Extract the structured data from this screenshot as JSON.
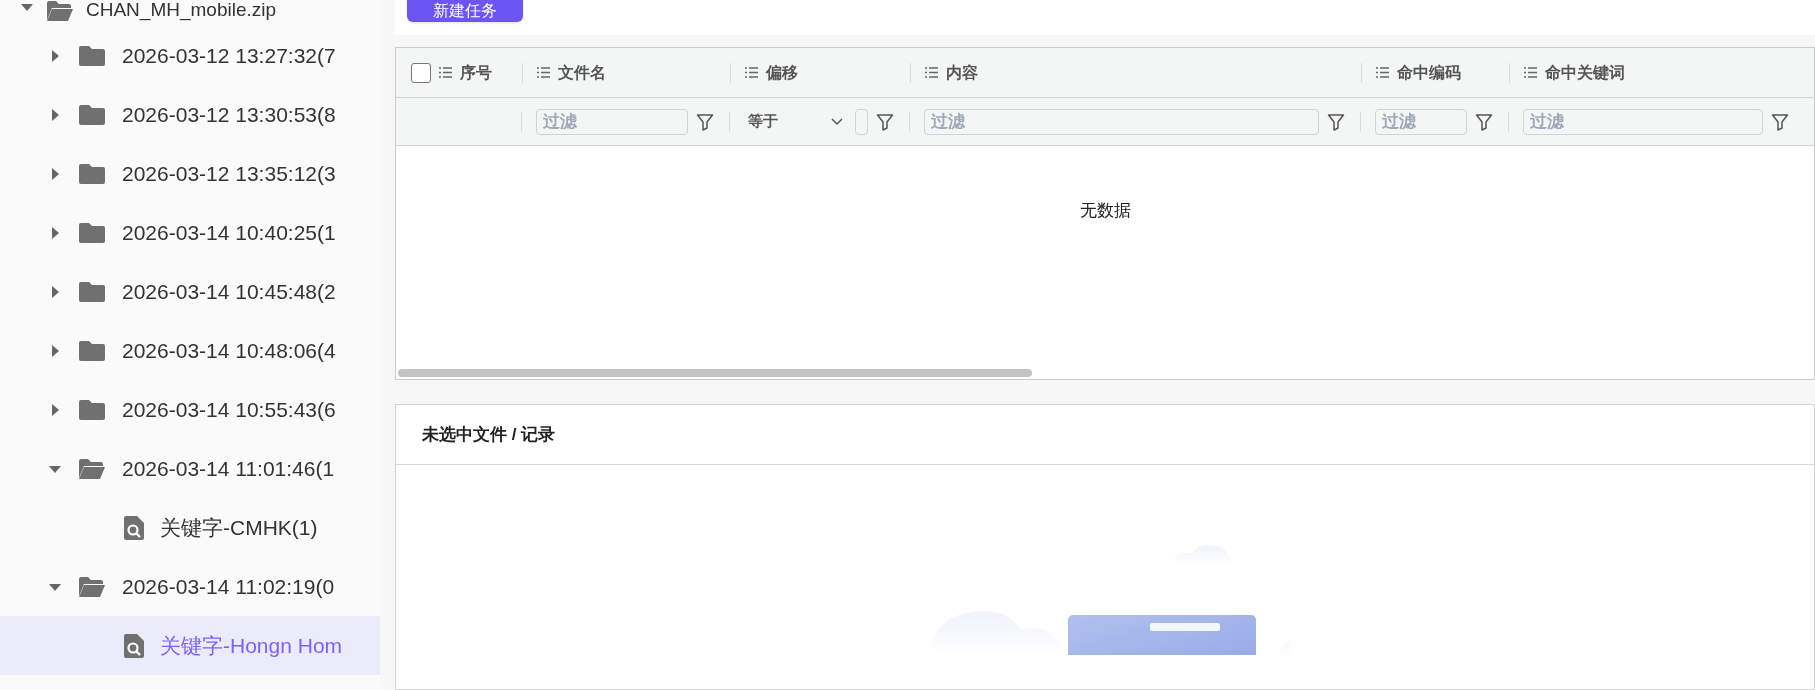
{
  "sidebar": {
    "root": {
      "label": "CHAN_MH_mobile.zip",
      "expanded": true
    },
    "items": [
      {
        "label": "2026-03-12 13:27:32(7",
        "expanded": false,
        "selected": false
      },
      {
        "label": "2026-03-12 13:30:53(8",
        "expanded": false,
        "selected": false
      },
      {
        "label": "2026-03-12 13:35:12(3",
        "expanded": false,
        "selected": false
      },
      {
        "label": "2026-03-14 10:40:25(1",
        "expanded": false,
        "selected": false
      },
      {
        "label": "2026-03-14 10:45:48(2",
        "expanded": false,
        "selected": false
      },
      {
        "label": "2026-03-14 10:48:06(4",
        "expanded": false,
        "selected": false
      },
      {
        "label": "2026-03-14 10:55:43(6",
        "expanded": false,
        "selected": false
      },
      {
        "label": "2026-03-14 11:01:46(1",
        "expanded": true,
        "selected": false,
        "children": [
          {
            "label": "关键字-CMHK(1)",
            "selected": false
          }
        ]
      },
      {
        "label": "2026-03-14 11:02:19(0",
        "expanded": true,
        "selected": false,
        "children": [
          {
            "label": "关键字-Hongn Hom",
            "selected": true
          }
        ]
      }
    ]
  },
  "toolbar": {
    "new_task_button": "新建任务"
  },
  "table": {
    "select_all": {
      "checked": false
    },
    "columns": [
      {
        "label": "序号"
      },
      {
        "label": "文件名",
        "filter": {
          "kind": "text",
          "placeholder": "过滤"
        }
      },
      {
        "label": "偏移",
        "filter": {
          "kind": "select",
          "value": "等于"
        }
      },
      {
        "label": "内容",
        "filter": {
          "kind": "text",
          "placeholder": "过滤"
        }
      },
      {
        "label": "命中编码",
        "filter": {
          "kind": "text",
          "placeholder": "过滤"
        }
      },
      {
        "label": "命中关键词",
        "filter": {
          "kind": "text",
          "placeholder": "过滤"
        }
      }
    ],
    "empty_text": "无数据"
  },
  "details": {
    "title": "未选中文件 / 记录"
  }
}
